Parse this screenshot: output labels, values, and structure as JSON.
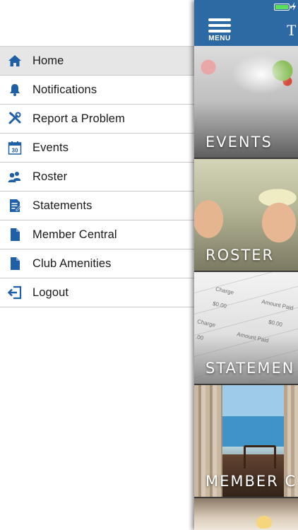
{
  "drawer": {
    "items": [
      {
        "label": "Home",
        "icon": "home-icon",
        "active": true
      },
      {
        "label": "Notifications",
        "icon": "bell-icon",
        "active": false
      },
      {
        "label": "Report a Problem",
        "icon": "tools-icon",
        "active": false
      },
      {
        "label": "Events",
        "icon": "calendar-icon",
        "active": false
      },
      {
        "label": "Roster",
        "icon": "people-icon",
        "active": false
      },
      {
        "label": "Statements",
        "icon": "statement-icon",
        "active": false
      },
      {
        "label": "Member Central",
        "icon": "document-icon",
        "active": false
      },
      {
        "label": "Club Amenities",
        "icon": "document-icon",
        "active": false
      },
      {
        "label": "Logout",
        "icon": "logout-icon",
        "active": false
      }
    ],
    "calendar_day": "30"
  },
  "header": {
    "menu_label": "MENU",
    "title_fragment": "T"
  },
  "tiles": [
    {
      "label": "EVENTS"
    },
    {
      "label": "ROSTER"
    },
    {
      "label": "STATEMEN"
    },
    {
      "label": "MEMBER C"
    }
  ],
  "statement_paper": {
    "charge": "Charge",
    "amount_paid": "Amount Paid",
    "zero_a": "$0.00",
    "zero_b": "$0.00",
    "zero_c": ".00"
  },
  "colors": {
    "brand_blue": "#2d6aa3",
    "icon_blue": "#1f5fa6",
    "active_row": "#e6e6e6",
    "battery_green": "#5be05b"
  }
}
